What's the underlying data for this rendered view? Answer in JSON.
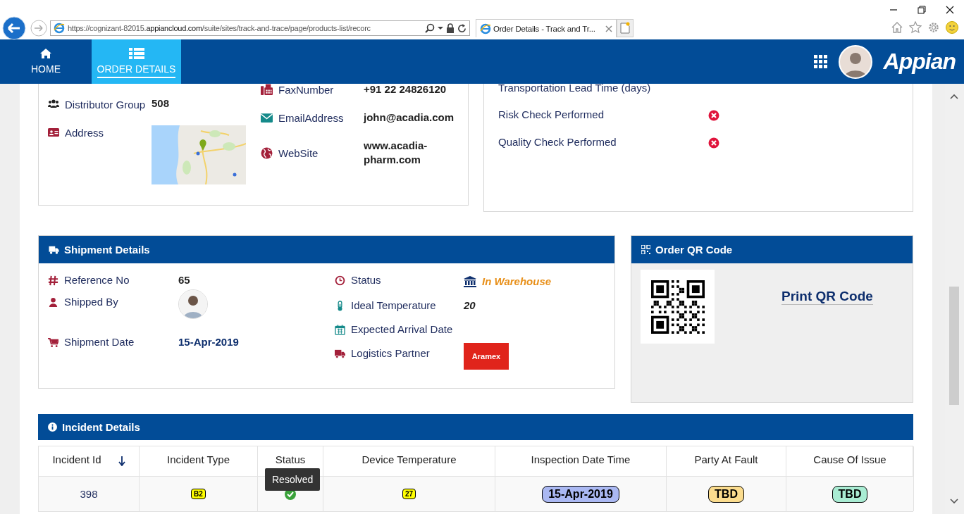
{
  "browser": {
    "url": "https://cognizant-82015.**appiancloud.com**/suite/sites/track-and-trace/page/products-list/recorc",
    "tab_title": "Order Details - Track and Tr..."
  },
  "nav": {
    "tabs": [
      {
        "label": "HOME",
        "selected": false
      },
      {
        "label": "ORDER DETAILS",
        "selected": true
      }
    ],
    "brand": "Appian"
  },
  "contact": {
    "left": [
      {
        "label": "Distributor Group",
        "kind": "text",
        "value": "508"
      },
      {
        "label": "Address",
        "kind": "map"
      }
    ],
    "middle": [
      {
        "label": "FaxNumber",
        "value": "+91 22 24826120"
      },
      {
        "label": "EmailAddress",
        "value": "john@acadia.com"
      },
      {
        "label": "WebSite",
        "value": "www.acadia-pharm.com"
      }
    ],
    "checks": [
      {
        "label": "Transportation Lead Time (days)",
        "kind": "text"
      },
      {
        "label": "Risk Check Performed",
        "kind": "check",
        "checked": false
      },
      {
        "label": "Quality Check Performed",
        "kind": "check",
        "checked": false
      }
    ]
  },
  "shipment": {
    "title": "Shipment Details",
    "left": [
      {
        "label": "Reference No",
        "kind": "bold",
        "value": "65"
      },
      {
        "label": "Shipped By",
        "kind": "avatar"
      },
      {
        "label": "Shipment Date",
        "kind": "date",
        "value": "15-Apr-2019"
      }
    ],
    "right": [
      {
        "label": "Status",
        "kind": "status",
        "value": "In Warehouse"
      },
      {
        "label": "Ideal Temperature",
        "kind": "italic",
        "value": "20"
      },
      {
        "label": "Expected Arrival Date",
        "kind": "empty"
      },
      {
        "label": "Logistics Partner",
        "kind": "logo",
        "value": "Aramex"
      }
    ]
  },
  "qr": {
    "title": "Order QR Code",
    "link": "Print QR Code"
  },
  "incident": {
    "title": "Incident Details",
    "tooltip": "Resolved",
    "columns": [
      {
        "label": "Incident Id",
        "sorted": true
      },
      {
        "label": "Incident Type",
        "sorted": false
      },
      {
        "label": "Status",
        "sorted": false
      },
      {
        "label": "Device Temperature",
        "sorted": false
      },
      {
        "label": "Inspection Date Time",
        "sorted": false
      },
      {
        "label": "Party At Fault",
        "sorted": false
      },
      {
        "label": "Cause Of Issue",
        "sorted": false
      }
    ],
    "rows": [
      {
        "cells": [
          {
            "kind": "link",
            "text": "398"
          },
          {
            "kind": "badge",
            "text": "B2",
            "color": "#ffff00"
          },
          {
            "kind": "status",
            "resolved": true
          },
          {
            "kind": "badge",
            "text": "27",
            "color": "#ffff00"
          },
          {
            "kind": "pill",
            "text": "15-Apr-2019",
            "color": "#aab8f2"
          },
          {
            "kind": "pill",
            "text": "TBD",
            "color": "#fbdc8e"
          },
          {
            "kind": "pill",
            "text": "TBD",
            "color": "#a9ecd3"
          }
        ]
      }
    ]
  }
}
